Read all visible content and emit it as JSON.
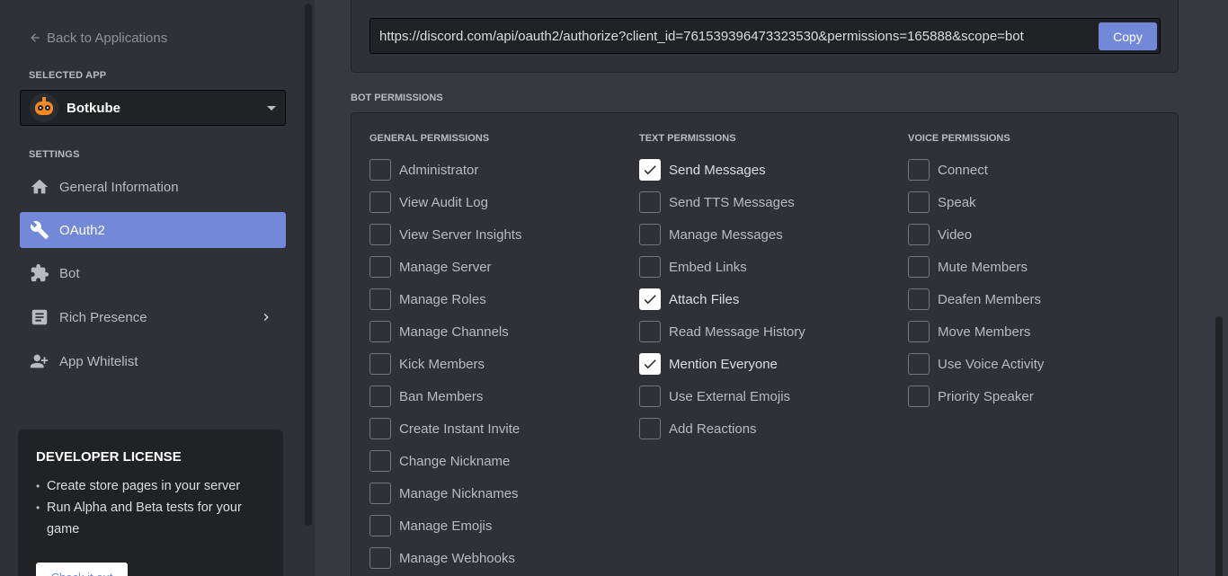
{
  "sidebar": {
    "back_label": "Back to Applications",
    "selected_app_label": "SELECTED APP",
    "selected_app_name": "Botkube",
    "settings_label": "SETTINGS",
    "items": [
      {
        "label": "General Information",
        "icon": "home-icon"
      },
      {
        "label": "OAuth2",
        "icon": "wrench-icon",
        "active": true
      },
      {
        "label": "Bot",
        "icon": "puzzle-icon"
      },
      {
        "label": "Rich Presence",
        "icon": "document-icon"
      },
      {
        "label": "App Whitelist",
        "icon": "person-add-icon"
      }
    ],
    "license": {
      "title": "DEVELOPER LICENSE",
      "bullets": [
        "Create store pages in your server",
        "Run Alpha and Beta tests for your game"
      ],
      "button_label": "Check it out"
    }
  },
  "oauth": {
    "url": "https://discord.com/api/oauth2/authorize?client_id=761539396473323530&permissions=165888&scope=bot",
    "copy_label": "Copy"
  },
  "bot_permissions": {
    "heading": "BOT PERMISSIONS",
    "columns": [
      {
        "title": "GENERAL PERMISSIONS",
        "items": [
          {
            "label": "Administrator",
            "checked": false
          },
          {
            "label": "View Audit Log",
            "checked": false
          },
          {
            "label": "View Server Insights",
            "checked": false
          },
          {
            "label": "Manage Server",
            "checked": false
          },
          {
            "label": "Manage Roles",
            "checked": false
          },
          {
            "label": "Manage Channels",
            "checked": false
          },
          {
            "label": "Kick Members",
            "checked": false
          },
          {
            "label": "Ban Members",
            "checked": false
          },
          {
            "label": "Create Instant Invite",
            "checked": false
          },
          {
            "label": "Change Nickname",
            "checked": false
          },
          {
            "label": "Manage Nicknames",
            "checked": false
          },
          {
            "label": "Manage Emojis",
            "checked": false
          },
          {
            "label": "Manage Webhooks",
            "checked": false
          }
        ]
      },
      {
        "title": "TEXT PERMISSIONS",
        "items": [
          {
            "label": "Send Messages",
            "checked": true
          },
          {
            "label": "Send TTS Messages",
            "checked": false
          },
          {
            "label": "Manage Messages",
            "checked": false
          },
          {
            "label": "Embed Links",
            "checked": false
          },
          {
            "label": "Attach Files",
            "checked": true
          },
          {
            "label": "Read Message History",
            "checked": false
          },
          {
            "label": "Mention Everyone",
            "checked": true
          },
          {
            "label": "Use External Emojis",
            "checked": false
          },
          {
            "label": "Add Reactions",
            "checked": false
          }
        ]
      },
      {
        "title": "VOICE PERMISSIONS",
        "items": [
          {
            "label": "Connect",
            "checked": false
          },
          {
            "label": "Speak",
            "checked": false
          },
          {
            "label": "Video",
            "checked": false
          },
          {
            "label": "Mute Members",
            "checked": false
          },
          {
            "label": "Deafen Members",
            "checked": false
          },
          {
            "label": "Move Members",
            "checked": false
          },
          {
            "label": "Use Voice Activity",
            "checked": false
          },
          {
            "label": "Priority Speaker",
            "checked": false
          }
        ]
      }
    ]
  },
  "colors": {
    "accent": "#7289da",
    "background": "#36393f",
    "sidebar": "#2f3136"
  }
}
